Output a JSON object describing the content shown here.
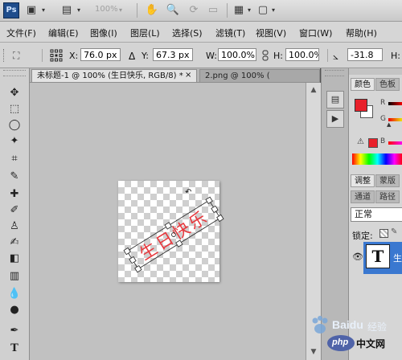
{
  "app": {
    "logo": "Ps",
    "zoom": "100%",
    "icons": [
      "launch-bridge-icon",
      "view-extras-icon",
      "zoom-level-dropdown",
      "hand-tool-icon",
      "zoom-tool-icon",
      "rotate-view-icon",
      "arrange-documents-icon",
      "screen-mode-icon"
    ]
  },
  "menu": {
    "items": [
      "文件(F)",
      "编辑(E)",
      "图像(I)",
      "图层(L)",
      "选择(S)",
      "滤镜(T)",
      "视图(V)",
      "窗口(W)",
      "帮助(H)"
    ]
  },
  "options": {
    "x_label": "X:",
    "x_value": "76.0 px",
    "y_label": "Y:",
    "y_value": "67.3 px",
    "w_label": "W:",
    "w_value": "100.0%",
    "h_label": "H:",
    "h_value": "100.0%",
    "angle_value": "-31.8",
    "h_skew_label": "H:"
  },
  "tabs": [
    {
      "label": "未标题-1 @ 100% (生日快乐, RGB/8) *",
      "close": "×"
    },
    {
      "label": "2.png @ 100% (",
      "close": ""
    }
  ],
  "canvas": {
    "text": "生日快乐",
    "text_color": "#e8383d"
  },
  "panels": {
    "color_tabs": [
      "颜色",
      "色板"
    ],
    "foreground_color": "#e8202a",
    "background_color": "#ffffff",
    "channel_labels": [
      "R",
      "G",
      "B"
    ],
    "adjust_tabs": [
      "调整",
      "蒙版"
    ],
    "layer_tabs": [
      "通道",
      "路径"
    ],
    "blend_mode": "正常",
    "lock_label": "锁定:",
    "layer_thumb": "T",
    "layer_name": "生"
  },
  "watermark": {
    "baidu": "Baidu",
    "jingyan": "经验",
    "php": "php",
    "site": "中文网"
  }
}
